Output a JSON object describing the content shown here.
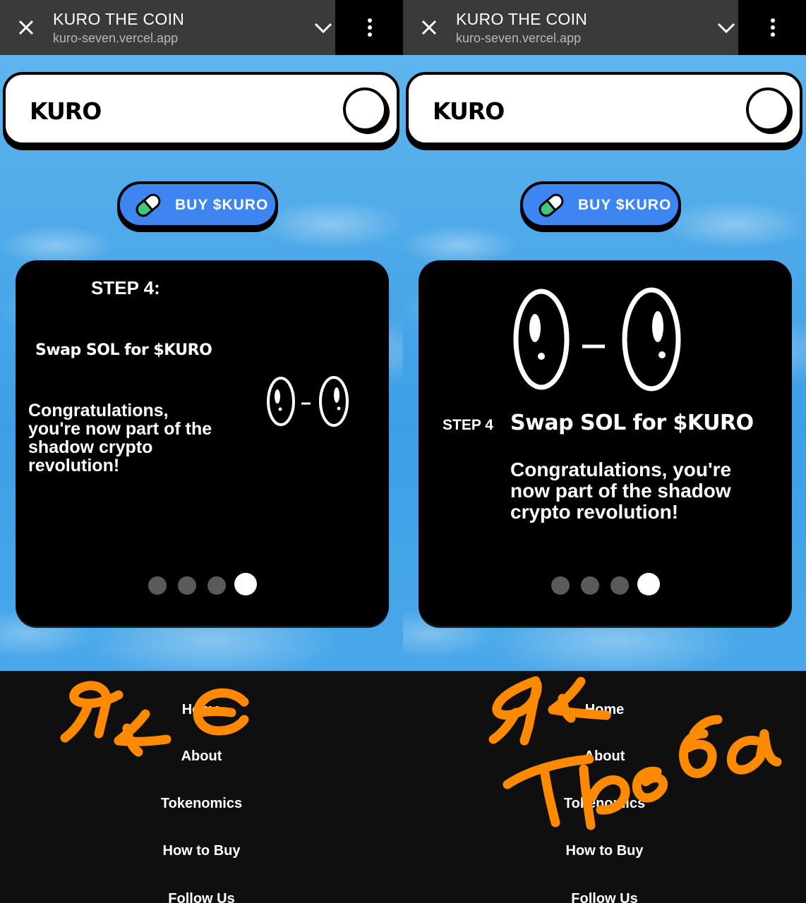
{
  "browser": {
    "title": "KURO THE COIN",
    "url": "kuro-seven.vercel.app",
    "close_icon": "close-icon",
    "expand_icon": "chevron-down-icon",
    "menu_icon": "more-vert-icon"
  },
  "site": {
    "logo": "KURO",
    "buy_label": "BUY $KURO"
  },
  "left_card": {
    "step": "STEP 4:",
    "heading": "Swap SOL for $KURO",
    "body": "Congratulations, you're now part of the shadow crypto revolution!",
    "active_dot": 4,
    "dot_count": 4
  },
  "right_card": {
    "step": "STEP 4",
    "heading": "Swap SOL for $KURO",
    "body": "Congratulations, you're now part of the shadow crypto revolution!",
    "active_dot": 4,
    "dot_count": 4
  },
  "footer": {
    "links": [
      "Home",
      "About",
      "Tokenomics",
      "How to Buy"
    ],
    "follow": "Follow Us"
  },
  "annotations": {
    "left": "як є",
    "right": "як треба",
    "color": "#ff8a00"
  },
  "colors": {
    "sky": "#4aa8ea",
    "button": "#3d86f2",
    "card": "#000000",
    "footer": "#0f0f0f"
  }
}
